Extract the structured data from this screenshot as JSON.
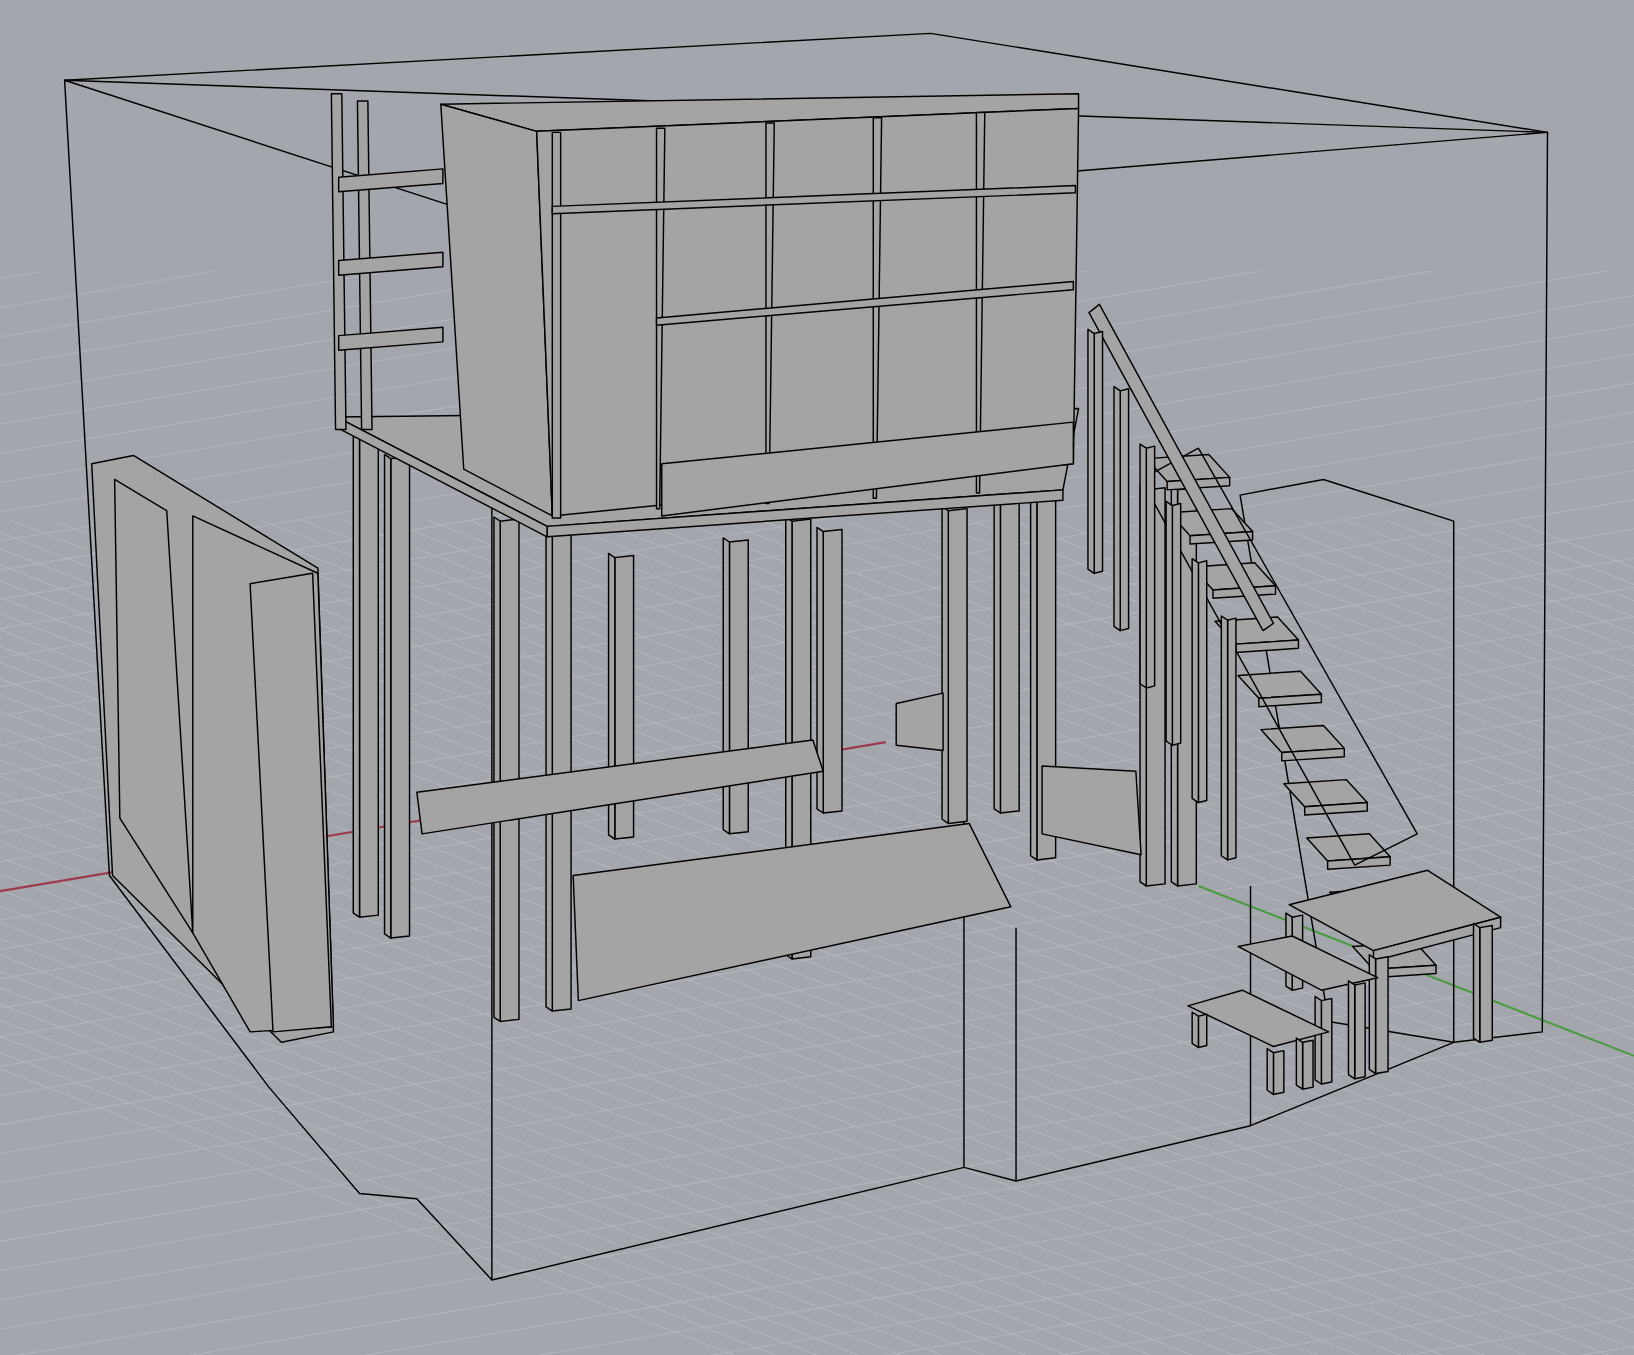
{
  "viewport": {
    "grid": true,
    "world_axes": true,
    "shaded": true
  }
}
